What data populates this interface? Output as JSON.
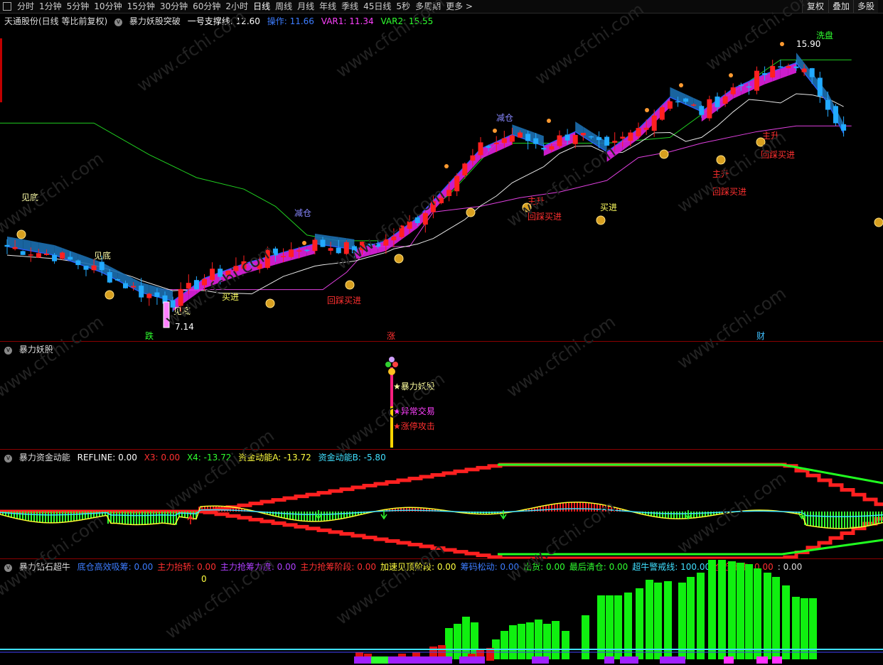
{
  "toolbar": {
    "periods": [
      "分时",
      "1分钟",
      "5分钟",
      "10分钟",
      "15分钟",
      "30分钟",
      "60分钟",
      "2小时",
      "日线",
      "周线",
      "月线",
      "年线",
      "季线",
      "45日线",
      "5秒",
      "多周期",
      "更多 >"
    ],
    "active_period": "日线",
    "right_buttons": [
      "复权",
      "叠加",
      "多股"
    ]
  },
  "main_panel": {
    "stock_title": "天通股份(日线 等比前复权)",
    "indicator_name": "暴力妖股突破",
    "support_label": "一号支撑线: 12.60",
    "operate_label": "操作: 11.66",
    "var1_label": "VAR1: 11.34",
    "var2_label": "VAR2: 15.55",
    "high_price": "15.90",
    "low_price": "7.14",
    "labels": {
      "jiandi": "见底",
      "jiancang": "减仓",
      "mairu": "买进",
      "huicai": "回踩买进",
      "zhusheng": "主升",
      "xipan": "洗盘",
      "die": "跌",
      "zhang": "涨",
      "cai": "财"
    }
  },
  "panel2": {
    "title": "暴力妖股",
    "tags": [
      "暴力妖股",
      "异常交易",
      "涨停攻击"
    ]
  },
  "panel3": {
    "title": "暴力资金动能",
    "refline": "REFLINE: 0.00",
    "x3": "X3: 0.00",
    "x4": "X4: -13.72",
    "a": "资金动能A: -13.72",
    "b": "资金动能B: -5.80"
  },
  "panel4": {
    "title": "暴力钻石超牛",
    "items": [
      {
        "text": "底仓高效吸筹: 0.00",
        "color": "#3d7dff"
      },
      {
        "text": "主力抬轿: 0.00",
        "color": "#ff3030"
      },
      {
        "text": "主力抢筹力度: 0.00",
        "color": "#b040ff"
      },
      {
        "text": "主力抢筹阶段: 0.00",
        "color": "#ff3030"
      },
      {
        "text": "加速见顶阶段: 0.00",
        "color": "#ffff40"
      },
      {
        "text": "筹码松动: 0.00",
        "color": "#3d7dff"
      },
      {
        "text": "出货: 0.00",
        "color": "#30ff30"
      },
      {
        "text": "最后清仓: 0.00",
        "color": "#30ff30"
      },
      {
        "text": "超牛警戒线: 100.00",
        "color": "#40e0ff"
      },
      {
        "text": "全仓出击: 0.00",
        "color": "#ff3030"
      },
      {
        "text": ": 0.00",
        "color": "#dddddd"
      }
    ],
    "zero": "0"
  },
  "watermark": "www.cfchi.com",
  "colors": {
    "up": "#ff2020",
    "down": "#22aaff",
    "green": "#20ff20",
    "magenta": "#ff30ff",
    "yellow": "#ffff40",
    "cyan": "#40e0ff"
  }
}
